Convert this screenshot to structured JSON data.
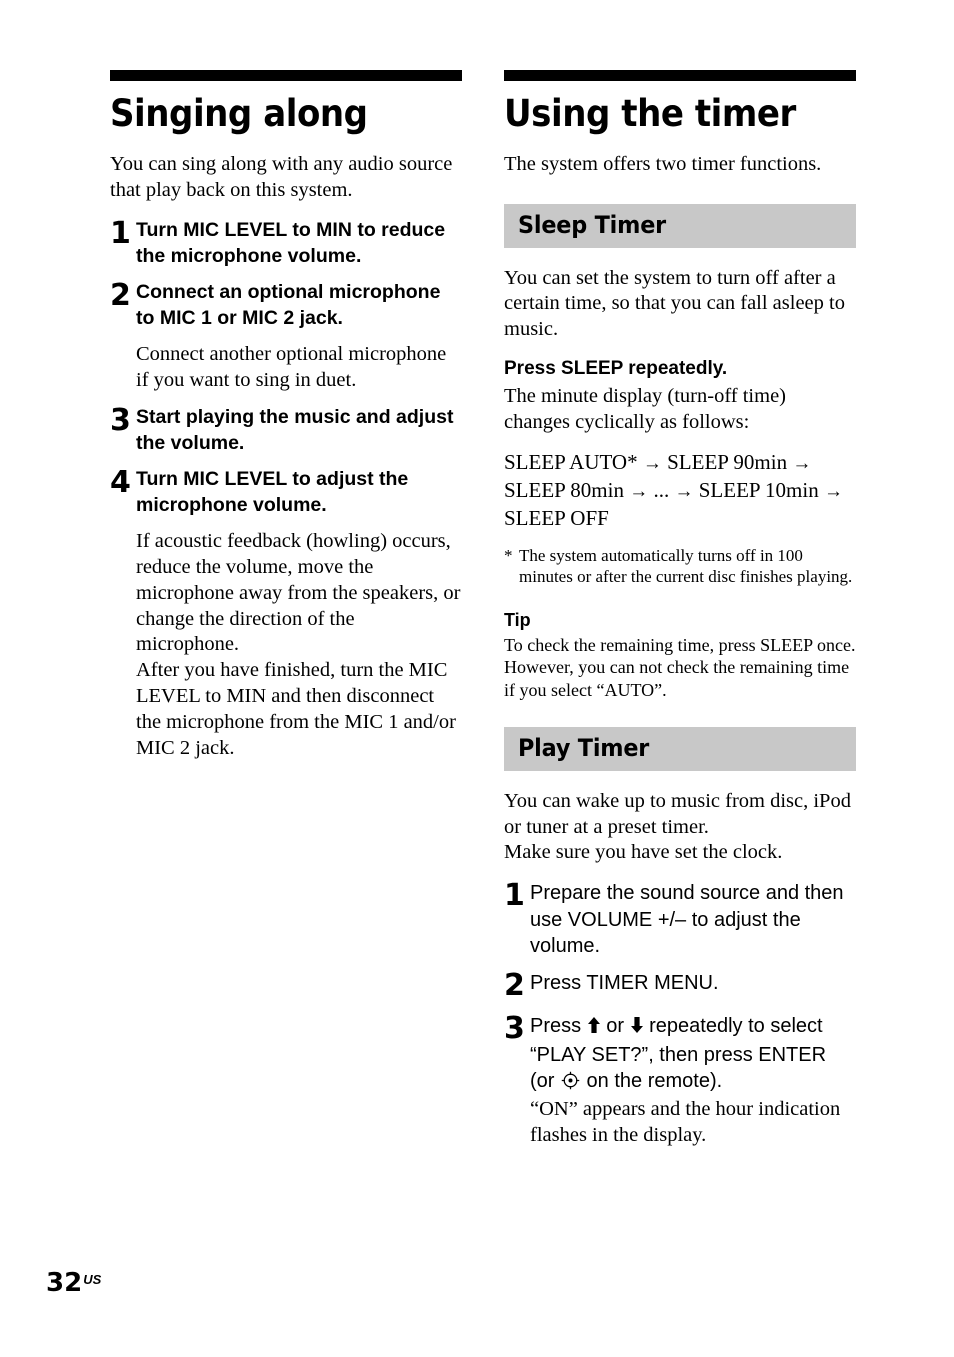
{
  "page": {
    "number": "32",
    "region": "US"
  },
  "left_column": {
    "chapter_title": "Singing along",
    "intro": "You can sing along with any audio source that play back on this system.",
    "steps": [
      {
        "num": "1",
        "text": "Turn MIC LEVEL to MIN to reduce the microphone volume.",
        "body": ""
      },
      {
        "num": "2",
        "text": "Connect an optional microphone to MIC 1 or MIC 2 jack.",
        "body": "Connect another optional microphone if you want to sing in duet."
      },
      {
        "num": "3",
        "text": "Start playing the music and adjust the volume.",
        "body": ""
      },
      {
        "num": "4",
        "text": "Turn MIC LEVEL to adjust the microphone volume.",
        "body": "If acoustic feedback (howling) occurs, reduce the volume, move the microphone away from the speakers, or change the direction of the microphone.\nAfter you have finished, turn the MIC LEVEL to MIN and then disconnect the microphone from the MIC 1 and/or MIC 2 jack."
      }
    ]
  },
  "right_column": {
    "chapter_title": "Using the timer",
    "intro": "The system offers two timer functions.",
    "sleep_timer": {
      "heading": "Sleep Timer",
      "intro": "You can set the system to turn off after a certain time, so that you can fall asleep to music.",
      "instruction_lead": "Press SLEEP repeatedly.",
      "instruction_body": "The minute display (turn-off time) changes cyclically as follows:",
      "sequence": [
        "SLEEP AUTO*",
        "SLEEP 90min",
        "SLEEP 80min",
        "...",
        "SLEEP 10min",
        "SLEEP OFF"
      ],
      "sequence_arrow": "→",
      "footnote_mark": "*",
      "footnote_text": "The system automatically turns off in 100 minutes or after the current disc finishes playing.",
      "tip_label": "Tip",
      "tip_text": "To check the remaining time, press SLEEP once. However, you can not check the remaining time if you select “AUTO”."
    },
    "play_timer": {
      "heading": "Play Timer",
      "intro_line1": "You can wake up to music from disc, iPod or tuner at a preset timer.",
      "intro_line2": "Make sure you have set the clock.",
      "steps": [
        {
          "num": "1",
          "text": "Prepare the sound source and then use VOLUME +/– to adjust the volume.",
          "body": ""
        },
        {
          "num": "2",
          "text": "Press TIMER MENU.",
          "body": ""
        },
        {
          "num": "3",
          "text_before_up": "Press ",
          "text_mid": " or ",
          "text_after_dn": " repeatedly to select “PLAY SET?”, then press ENTER (or ",
          "text_tail": " on the remote).",
          "body": "“ON” appears and the hour indication flashes in the display."
        }
      ]
    }
  },
  "colors": {
    "rule": "#000000",
    "subsection_background": "#c8c8c8",
    "text": "#000000",
    "page_background": "#ffffff"
  }
}
